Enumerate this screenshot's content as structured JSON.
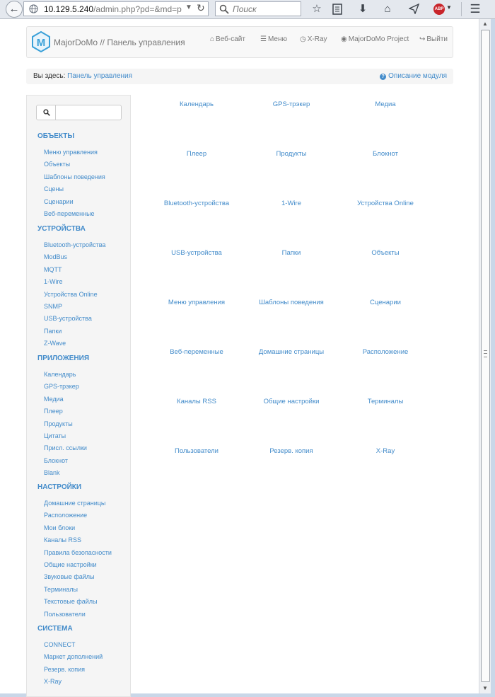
{
  "browser": {
    "url_host": "10.129.5.240",
    "url_path": "/admin.php?pd=&md=p",
    "search_placeholder": "Поиск",
    "adblock_label": "ABP"
  },
  "navbar": {
    "brand": "MajorDoMo // Панель управления",
    "logo_letter": "M",
    "links": [
      {
        "label": "Веб-сайт",
        "icon": "home-icon"
      },
      {
        "label": "Меню",
        "icon": "list-icon"
      },
      {
        "label": "X-Ray",
        "icon": "clock-icon"
      },
      {
        "label": "MajorDoMo Project",
        "icon": "globe-icon"
      },
      {
        "label": "Выйти",
        "icon": "logout-icon"
      }
    ]
  },
  "breadcrumb": {
    "prefix": "Вы здесь:",
    "current": "Панель управления",
    "help": "Описание модуля"
  },
  "sidebar": {
    "sections": [
      {
        "title": "ОБЪЕКТЫ",
        "items": [
          "Меню управления",
          "Объекты",
          "Шаблоны поведения",
          "Сцены",
          "Сценарии",
          "Веб-переменные"
        ]
      },
      {
        "title": "УСТРОЙСТВА",
        "items": [
          "Bluetooth-устройства",
          "ModBus",
          "MQTT",
          "1-Wire",
          "Устройства Online",
          "SNMP",
          "USB-устройства",
          "Папки",
          "Z-Wave"
        ]
      },
      {
        "title": "ПРИЛОЖЕНИЯ",
        "items": [
          "Календарь",
          "GPS-трэкер",
          "Медиа",
          "Плеер",
          "Продукты",
          "Цитаты",
          "Присл. ссылки",
          "Блокнот",
          "Blank"
        ]
      },
      {
        "title": "НАСТРОЙКИ",
        "items": [
          "Домашние страницы",
          "Расположение",
          "Мои блоки",
          "Каналы RSS",
          "Правила безопасности",
          "Общие настройки",
          "Звуковые файлы",
          "Терминалы",
          "Текстовые файлы",
          "Пользователи"
        ]
      },
      {
        "title": "СИСТЕМА",
        "items": [
          "CONNECT",
          "Маркет дополнений",
          "Резерв. копия",
          "X-Ray"
        ]
      }
    ]
  },
  "main": {
    "rows": [
      [
        "Календарь",
        "GPS-трэкер",
        "Медиа"
      ],
      [
        "Плеер",
        "Продукты",
        "Блокнот"
      ],
      [
        "Bluetooth-устройства",
        "1-Wire",
        "Устройства Online"
      ],
      [
        "USB-устройства",
        "Папки",
        "Объекты"
      ],
      [
        "Меню управления",
        "Шаблоны поведения",
        "Сценарии"
      ],
      [
        "Веб-переменные",
        "Домашние страницы",
        "Расположение"
      ],
      [
        "Каналы RSS",
        "Общие настройки",
        "Терминалы"
      ],
      [
        "Пользователи",
        "Резерв. копия",
        "X-Ray"
      ]
    ]
  }
}
